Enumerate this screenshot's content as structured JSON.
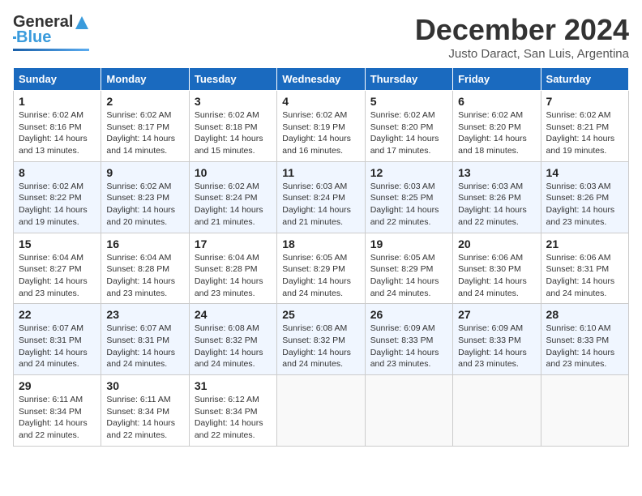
{
  "header": {
    "logo_line1": "General",
    "logo_line2": "Blue",
    "month": "December 2024",
    "location": "Justo Daract, San Luis, Argentina"
  },
  "weekdays": [
    "Sunday",
    "Monday",
    "Tuesday",
    "Wednesday",
    "Thursday",
    "Friday",
    "Saturday"
  ],
  "weeks": [
    [
      {
        "day": "1",
        "info": "Sunrise: 6:02 AM\nSunset: 8:16 PM\nDaylight: 14 hours and 13 minutes."
      },
      {
        "day": "2",
        "info": "Sunrise: 6:02 AM\nSunset: 8:17 PM\nDaylight: 14 hours and 14 minutes."
      },
      {
        "day": "3",
        "info": "Sunrise: 6:02 AM\nSunset: 8:18 PM\nDaylight: 14 hours and 15 minutes."
      },
      {
        "day": "4",
        "info": "Sunrise: 6:02 AM\nSunset: 8:19 PM\nDaylight: 14 hours and 16 minutes."
      },
      {
        "day": "5",
        "info": "Sunrise: 6:02 AM\nSunset: 8:20 PM\nDaylight: 14 hours and 17 minutes."
      },
      {
        "day": "6",
        "info": "Sunrise: 6:02 AM\nSunset: 8:20 PM\nDaylight: 14 hours and 18 minutes."
      },
      {
        "day": "7",
        "info": "Sunrise: 6:02 AM\nSunset: 8:21 PM\nDaylight: 14 hours and 19 minutes."
      }
    ],
    [
      {
        "day": "8",
        "info": "Sunrise: 6:02 AM\nSunset: 8:22 PM\nDaylight: 14 hours and 19 minutes."
      },
      {
        "day": "9",
        "info": "Sunrise: 6:02 AM\nSunset: 8:23 PM\nDaylight: 14 hours and 20 minutes."
      },
      {
        "day": "10",
        "info": "Sunrise: 6:02 AM\nSunset: 8:24 PM\nDaylight: 14 hours and 21 minutes."
      },
      {
        "day": "11",
        "info": "Sunrise: 6:03 AM\nSunset: 8:24 PM\nDaylight: 14 hours and 21 minutes."
      },
      {
        "day": "12",
        "info": "Sunrise: 6:03 AM\nSunset: 8:25 PM\nDaylight: 14 hours and 22 minutes."
      },
      {
        "day": "13",
        "info": "Sunrise: 6:03 AM\nSunset: 8:26 PM\nDaylight: 14 hours and 22 minutes."
      },
      {
        "day": "14",
        "info": "Sunrise: 6:03 AM\nSunset: 8:26 PM\nDaylight: 14 hours and 23 minutes."
      }
    ],
    [
      {
        "day": "15",
        "info": "Sunrise: 6:04 AM\nSunset: 8:27 PM\nDaylight: 14 hours and 23 minutes."
      },
      {
        "day": "16",
        "info": "Sunrise: 6:04 AM\nSunset: 8:28 PM\nDaylight: 14 hours and 23 minutes."
      },
      {
        "day": "17",
        "info": "Sunrise: 6:04 AM\nSunset: 8:28 PM\nDaylight: 14 hours and 23 minutes."
      },
      {
        "day": "18",
        "info": "Sunrise: 6:05 AM\nSunset: 8:29 PM\nDaylight: 14 hours and 24 minutes."
      },
      {
        "day": "19",
        "info": "Sunrise: 6:05 AM\nSunset: 8:29 PM\nDaylight: 14 hours and 24 minutes."
      },
      {
        "day": "20",
        "info": "Sunrise: 6:06 AM\nSunset: 8:30 PM\nDaylight: 14 hours and 24 minutes."
      },
      {
        "day": "21",
        "info": "Sunrise: 6:06 AM\nSunset: 8:31 PM\nDaylight: 14 hours and 24 minutes."
      }
    ],
    [
      {
        "day": "22",
        "info": "Sunrise: 6:07 AM\nSunset: 8:31 PM\nDaylight: 14 hours and 24 minutes."
      },
      {
        "day": "23",
        "info": "Sunrise: 6:07 AM\nSunset: 8:31 PM\nDaylight: 14 hours and 24 minutes."
      },
      {
        "day": "24",
        "info": "Sunrise: 6:08 AM\nSunset: 8:32 PM\nDaylight: 14 hours and 24 minutes."
      },
      {
        "day": "25",
        "info": "Sunrise: 6:08 AM\nSunset: 8:32 PM\nDaylight: 14 hours and 24 minutes."
      },
      {
        "day": "26",
        "info": "Sunrise: 6:09 AM\nSunset: 8:33 PM\nDaylight: 14 hours and 23 minutes."
      },
      {
        "day": "27",
        "info": "Sunrise: 6:09 AM\nSunset: 8:33 PM\nDaylight: 14 hours and 23 minutes."
      },
      {
        "day": "28",
        "info": "Sunrise: 6:10 AM\nSunset: 8:33 PM\nDaylight: 14 hours and 23 minutes."
      }
    ],
    [
      {
        "day": "29",
        "info": "Sunrise: 6:11 AM\nSunset: 8:34 PM\nDaylight: 14 hours and 22 minutes."
      },
      {
        "day": "30",
        "info": "Sunrise: 6:11 AM\nSunset: 8:34 PM\nDaylight: 14 hours and 22 minutes."
      },
      {
        "day": "31",
        "info": "Sunrise: 6:12 AM\nSunset: 8:34 PM\nDaylight: 14 hours and 22 minutes."
      },
      null,
      null,
      null,
      null
    ]
  ]
}
